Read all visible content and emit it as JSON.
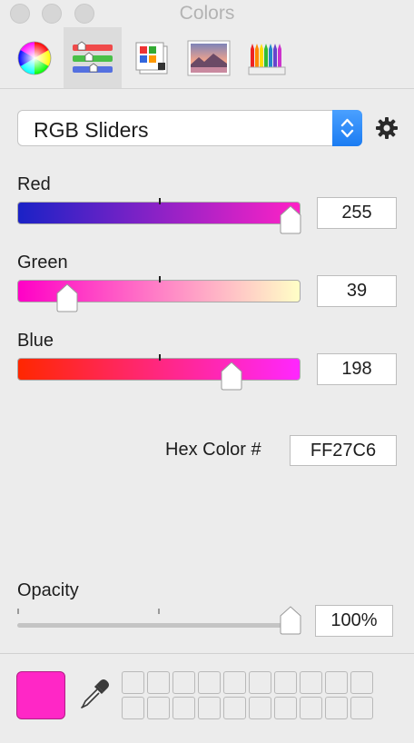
{
  "window": {
    "title": "Colors"
  },
  "toolbar": {
    "tabs": [
      {
        "name": "color-wheel",
        "selected": false
      },
      {
        "name": "color-sliders",
        "selected": true
      },
      {
        "name": "color-palettes",
        "selected": false
      },
      {
        "name": "image-palettes",
        "selected": false
      },
      {
        "name": "pencils",
        "selected": false
      }
    ]
  },
  "mode_popup": {
    "selected": "RGB Sliders"
  },
  "sliders": [
    {
      "label": "Red",
      "value": "255",
      "fraction": 1.0,
      "gradient": [
        "#1a22c6",
        "#ff22c6"
      ]
    },
    {
      "label": "Green",
      "value": "39",
      "fraction": 0.153,
      "gradient": [
        "#ff00c6",
        "#ffffc6"
      ]
    },
    {
      "label": "Blue",
      "value": "198",
      "fraction": 0.776,
      "gradient": [
        "#ff2700",
        "#ff27ff"
      ]
    }
  ],
  "hex": {
    "label": "Hex Color #",
    "value": "FF27C6"
  },
  "opacity": {
    "label": "Opacity",
    "value": "100%",
    "fraction": 1.0
  },
  "current_color": "#ff27c6",
  "color_wells": {
    "count": 20
  }
}
